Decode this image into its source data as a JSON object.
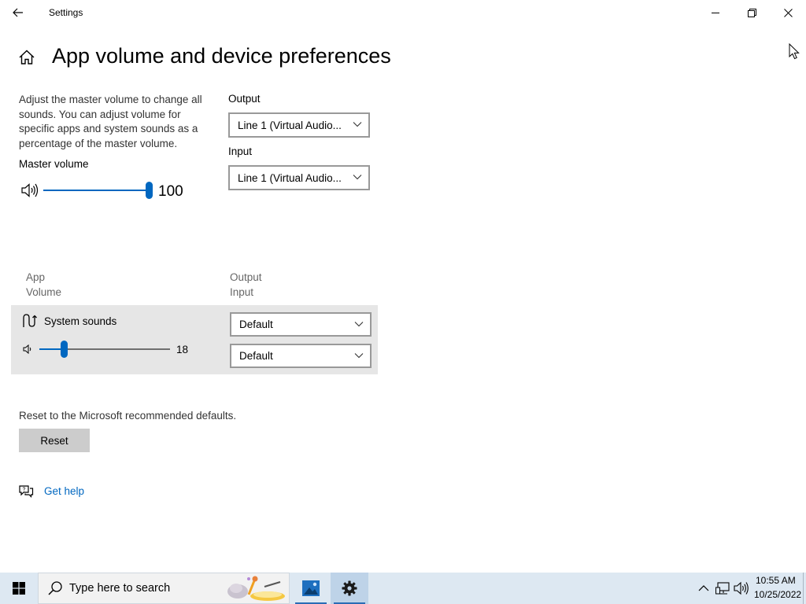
{
  "window": {
    "title": "Settings"
  },
  "page": {
    "title": "App volume and device preferences",
    "description": "Adjust the master volume to change all sounds. You can adjust volume for specific apps and system sounds as a percentage of the master volume."
  },
  "master": {
    "label": "Master volume",
    "value": "100",
    "level": 1.0
  },
  "devices": {
    "output_label": "Output",
    "output_value": "Line 1 (Virtual Audio...",
    "input_label": "Input",
    "input_value": "Line 1 (Virtual Audio..."
  },
  "columns": {
    "app": "App",
    "volume": "Volume",
    "output": "Output",
    "input": "Input"
  },
  "apps": [
    {
      "name": "System sounds",
      "volume": "18",
      "level": 0.18,
      "output": "Default",
      "input": "Default"
    }
  ],
  "reset": {
    "text": "Reset to the Microsoft recommended defaults.",
    "button": "Reset"
  },
  "help": {
    "label": "Get help"
  },
  "taskbar": {
    "search_placeholder": "Type here to search",
    "time": "10:55 AM",
    "date": "10/25/2022"
  },
  "colors": {
    "accent": "#0067c0",
    "app_row_bg": "#e6e6e6",
    "taskbar_bg": "#dde8f2"
  },
  "icons": [
    "back-arrow-icon",
    "minimize-icon",
    "restore-icon",
    "close-icon",
    "home-icon",
    "speaker-icon",
    "system-sounds-icon",
    "chevron-down-icon",
    "help-chat-icon",
    "windows-logo-icon",
    "search-icon",
    "photos-icon",
    "gear-icon",
    "chevron-up-icon",
    "network-icon",
    "volume-icon",
    "mouse-cursor-icon"
  ]
}
